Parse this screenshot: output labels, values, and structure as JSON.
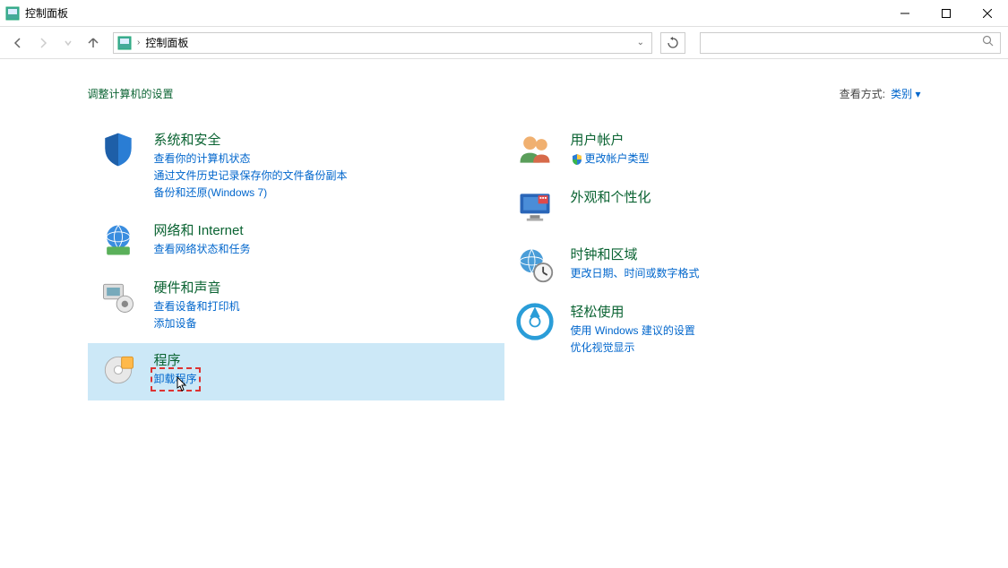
{
  "window": {
    "title": "控制面板"
  },
  "breadcrumb": {
    "location": "控制面板"
  },
  "search": {
    "placeholder": ""
  },
  "header": {
    "title": "调整计算机的设置",
    "viewby_label": "查看方式:",
    "viewby_value": "类别"
  },
  "left_categories": [
    {
      "id": "system-security",
      "title": "系统和安全",
      "links": [
        "查看你的计算机状态",
        "通过文件历史记录保存你的文件备份副本",
        "备份和还原(Windows 7)"
      ]
    },
    {
      "id": "network",
      "title": "网络和 Internet",
      "links": [
        "查看网络状态和任务"
      ]
    },
    {
      "id": "hardware",
      "title": "硬件和声音",
      "links": [
        "查看设备和打印机",
        "添加设备"
      ]
    },
    {
      "id": "programs",
      "title": "程序",
      "links": [
        "卸载程序"
      ],
      "highlighted": true
    }
  ],
  "right_categories": [
    {
      "id": "accounts",
      "title": "用户帐户",
      "links": [
        "更改帐户类型"
      ],
      "shield": true
    },
    {
      "id": "appearance",
      "title": "外观和个性化",
      "links": []
    },
    {
      "id": "clock",
      "title": "时钟和区域",
      "links": [
        "更改日期、时间或数字格式"
      ]
    },
    {
      "id": "ease",
      "title": "轻松使用",
      "links": [
        "使用 Windows 建议的设置",
        "优化视觉显示"
      ]
    }
  ]
}
